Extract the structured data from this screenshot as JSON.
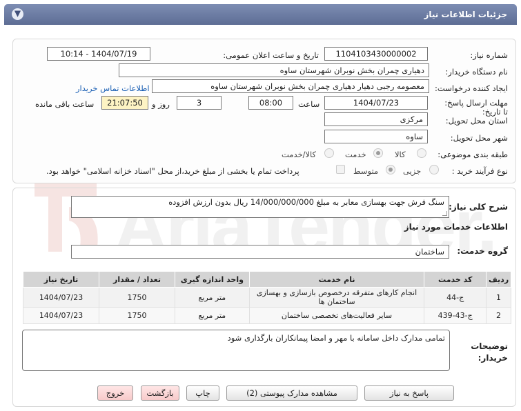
{
  "window": {
    "title": "جزئیات اطلاعات نیاز"
  },
  "form": {
    "need_number": {
      "label": "شماره نیاز:",
      "value": "1104103430000002"
    },
    "announce_datetime": {
      "label": "تاریخ و ساعت اعلان عمومی:",
      "value": "1404/07/19 - 10:14"
    },
    "buyer_org": {
      "label": "نام دستگاه خریدار:",
      "value": "دهیاری چمران بخش نوبران شهرستان ساوه"
    },
    "requester": {
      "label": "ایجاد کننده درخواست:",
      "value": "معصومه رجبی دهیار دهیاری چمران بخش نوبران شهرستان ساوه",
      "contact_link": "اطلاعات تماس خریدار"
    },
    "deadline": {
      "label": "مهلت ارسال پاسخ: تا تاریخ:",
      "date": "1404/07/23",
      "time_label": "ساعت",
      "time": "08:00",
      "days": "3",
      "days_label": "روز و",
      "remaining": "21:07:50",
      "remaining_label": "ساعت باقی مانده"
    },
    "province": {
      "label": "استان محل تحویل:",
      "value": "مرکزی"
    },
    "city": {
      "label": "شهر محل تحویل:",
      "value": "ساوه"
    },
    "category": {
      "label": "طبقه بندی موضوعی:",
      "options": [
        "کالا",
        "خدمت",
        "کالا/خدمت"
      ],
      "selected": "خدمت"
    },
    "purchase_type": {
      "label": "نوع فرآیند خرید :",
      "options": [
        "جزیی",
        "متوسط"
      ],
      "selected": "متوسط",
      "treasury_note": "پرداخت تمام یا بخشی از مبلغ خرید،از محل \"اسناد خزانه اسلامی\" خواهد بود."
    }
  },
  "summary": {
    "label": "شرح کلی نیاز:",
    "value": "سنگ فرش جهت بهسازی معابر به مبلغ 14/000/000/000 ریال بدون ارزش افزوده"
  },
  "services": {
    "section_title": "اطلاعات خدمات مورد نیاز",
    "group_label": "گروه خدمت:",
    "group_value": "ساختمان",
    "columns": [
      "ردیف",
      "کد خدمت",
      "نام خدمت",
      "واحد اندازه گیری",
      "تعداد / مقدار",
      "تاریخ نیاز"
    ],
    "rows": [
      {
        "index": "1",
        "code": "ج-44",
        "name": "انجام کارهای متفرقه درخصوص بازسازی و بهسازی ساختمان ها",
        "unit": "متر مربع",
        "qty": "1750",
        "date": "1404/07/23"
      },
      {
        "index": "2",
        "code": "ج-43-439",
        "name": "سایر فعالیت‌های تخصصی ساختمان",
        "unit": "متر مربع",
        "qty": "1750",
        "date": "1404/07/23"
      }
    ]
  },
  "buyer_notes": {
    "label": "توضیحات خریدار:",
    "value": "تمامی مدارک داخل سامانه با مهر و امضا پیمانکاران بارگذاری شود"
  },
  "buttons": {
    "reply": "پاسخ به نیاز",
    "attachments": "مشاهده مدارک پیوستی (2)",
    "print": "چاپ",
    "back": "بازگشت",
    "exit": "خروج"
  },
  "watermark_text": "AriaTender.net",
  "colors": {
    "titlebar": "#6a7aa0",
    "link": "#1a5fb4",
    "highlight": "#fdf3c4"
  }
}
